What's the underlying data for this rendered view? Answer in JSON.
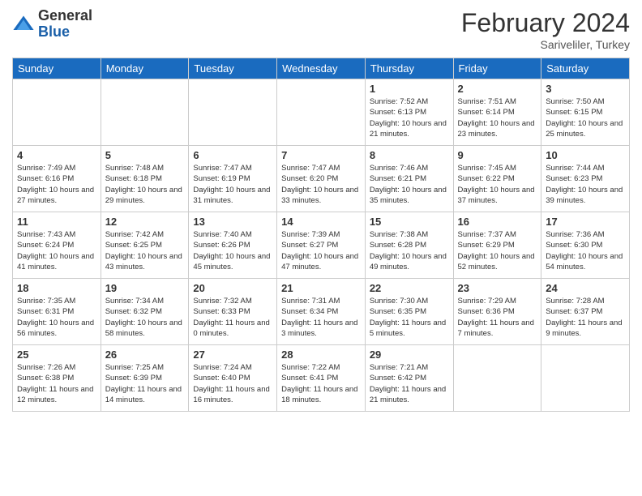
{
  "logo": {
    "general": "General",
    "blue": "Blue"
  },
  "header": {
    "month": "February 2024",
    "location": "Sariveliler, Turkey"
  },
  "weekdays": [
    "Sunday",
    "Monday",
    "Tuesday",
    "Wednesday",
    "Thursday",
    "Friday",
    "Saturday"
  ],
  "weeks": [
    [
      null,
      null,
      null,
      null,
      {
        "day": 1,
        "sunrise": "7:52 AM",
        "sunset": "6:13 PM",
        "daylight": "10 hours and 21 minutes."
      },
      {
        "day": 2,
        "sunrise": "7:51 AM",
        "sunset": "6:14 PM",
        "daylight": "10 hours and 23 minutes."
      },
      {
        "day": 3,
        "sunrise": "7:50 AM",
        "sunset": "6:15 PM",
        "daylight": "10 hours and 25 minutes."
      }
    ],
    [
      {
        "day": 4,
        "sunrise": "7:49 AM",
        "sunset": "6:16 PM",
        "daylight": "10 hours and 27 minutes."
      },
      {
        "day": 5,
        "sunrise": "7:48 AM",
        "sunset": "6:18 PM",
        "daylight": "10 hours and 29 minutes."
      },
      {
        "day": 6,
        "sunrise": "7:47 AM",
        "sunset": "6:19 PM",
        "daylight": "10 hours and 31 minutes."
      },
      {
        "day": 7,
        "sunrise": "7:47 AM",
        "sunset": "6:20 PM",
        "daylight": "10 hours and 33 minutes."
      },
      {
        "day": 8,
        "sunrise": "7:46 AM",
        "sunset": "6:21 PM",
        "daylight": "10 hours and 35 minutes."
      },
      {
        "day": 9,
        "sunrise": "7:45 AM",
        "sunset": "6:22 PM",
        "daylight": "10 hours and 37 minutes."
      },
      {
        "day": 10,
        "sunrise": "7:44 AM",
        "sunset": "6:23 PM",
        "daylight": "10 hours and 39 minutes."
      }
    ],
    [
      {
        "day": 11,
        "sunrise": "7:43 AM",
        "sunset": "6:24 PM",
        "daylight": "10 hours and 41 minutes."
      },
      {
        "day": 12,
        "sunrise": "7:42 AM",
        "sunset": "6:25 PM",
        "daylight": "10 hours and 43 minutes."
      },
      {
        "day": 13,
        "sunrise": "7:40 AM",
        "sunset": "6:26 PM",
        "daylight": "10 hours and 45 minutes."
      },
      {
        "day": 14,
        "sunrise": "7:39 AM",
        "sunset": "6:27 PM",
        "daylight": "10 hours and 47 minutes."
      },
      {
        "day": 15,
        "sunrise": "7:38 AM",
        "sunset": "6:28 PM",
        "daylight": "10 hours and 49 minutes."
      },
      {
        "day": 16,
        "sunrise": "7:37 AM",
        "sunset": "6:29 PM",
        "daylight": "10 hours and 52 minutes."
      },
      {
        "day": 17,
        "sunrise": "7:36 AM",
        "sunset": "6:30 PM",
        "daylight": "10 hours and 54 minutes."
      }
    ],
    [
      {
        "day": 18,
        "sunrise": "7:35 AM",
        "sunset": "6:31 PM",
        "daylight": "10 hours and 56 minutes."
      },
      {
        "day": 19,
        "sunrise": "7:34 AM",
        "sunset": "6:32 PM",
        "daylight": "10 hours and 58 minutes."
      },
      {
        "day": 20,
        "sunrise": "7:32 AM",
        "sunset": "6:33 PM",
        "daylight": "11 hours and 0 minutes."
      },
      {
        "day": 21,
        "sunrise": "7:31 AM",
        "sunset": "6:34 PM",
        "daylight": "11 hours and 3 minutes."
      },
      {
        "day": 22,
        "sunrise": "7:30 AM",
        "sunset": "6:35 PM",
        "daylight": "11 hours and 5 minutes."
      },
      {
        "day": 23,
        "sunrise": "7:29 AM",
        "sunset": "6:36 PM",
        "daylight": "11 hours and 7 minutes."
      },
      {
        "day": 24,
        "sunrise": "7:28 AM",
        "sunset": "6:37 PM",
        "daylight": "11 hours and 9 minutes."
      }
    ],
    [
      {
        "day": 25,
        "sunrise": "7:26 AM",
        "sunset": "6:38 PM",
        "daylight": "11 hours and 12 minutes."
      },
      {
        "day": 26,
        "sunrise": "7:25 AM",
        "sunset": "6:39 PM",
        "daylight": "11 hours and 14 minutes."
      },
      {
        "day": 27,
        "sunrise": "7:24 AM",
        "sunset": "6:40 PM",
        "daylight": "11 hours and 16 minutes."
      },
      {
        "day": 28,
        "sunrise": "7:22 AM",
        "sunset": "6:41 PM",
        "daylight": "11 hours and 18 minutes."
      },
      {
        "day": 29,
        "sunrise": "7:21 AM",
        "sunset": "6:42 PM",
        "daylight": "11 hours and 21 minutes."
      },
      null,
      null
    ]
  ]
}
